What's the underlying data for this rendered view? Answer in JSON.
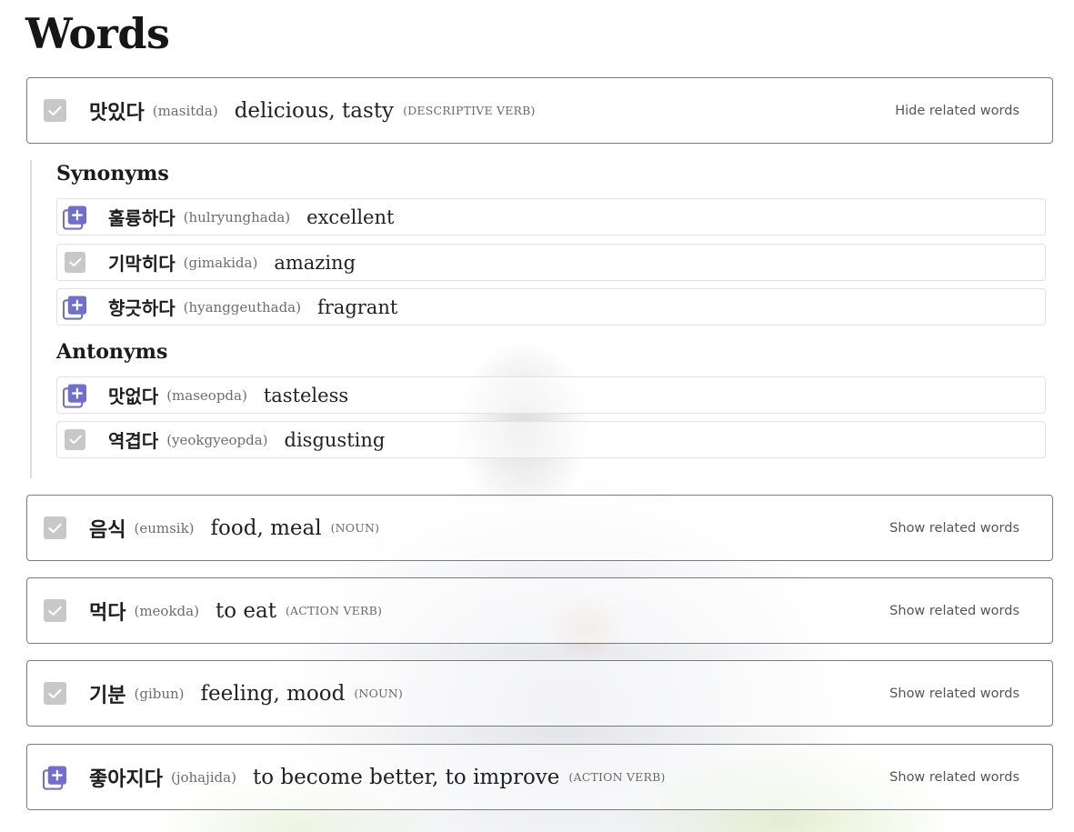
{
  "page": {
    "title": "Words"
  },
  "colors": {
    "add_icon": "#6f6fd0",
    "check_bg": "#c8c8c8",
    "card_border": "#7b7b7b"
  },
  "words": [
    {
      "korean": "맛있다",
      "romanization": "(masitda)",
      "english": "delicious, tasty",
      "pos": "(DESCRIPTIVE VERB)",
      "toggle_label": "Hide related words",
      "status_icon": "check-icon"
    },
    {
      "korean": "음식",
      "romanization": "(eumsik)",
      "english": "food, meal",
      "pos": "(NOUN)",
      "toggle_label": "Show related words",
      "status_icon": "check-icon"
    },
    {
      "korean": "먹다",
      "romanization": "(meokda)",
      "english": "to eat",
      "pos": "(ACTION VERB)",
      "toggle_label": "Show related words",
      "status_icon": "check-icon"
    },
    {
      "korean": "기분",
      "romanization": "(gibun)",
      "english": "feeling, mood",
      "pos": "(NOUN)",
      "toggle_label": "Show related words",
      "status_icon": "check-icon"
    },
    {
      "korean": "좋아지다",
      "romanization": "(johajida)",
      "english": "to become better, to improve",
      "pos": "(ACTION VERB)",
      "toggle_label": "Show related words",
      "status_icon": "add-to-list-icon"
    }
  ],
  "related": {
    "synonyms_heading": "Synonyms",
    "synonyms": [
      {
        "korean": "훌륭하다",
        "romanization": "(hulryunghada)",
        "english": "excellent",
        "status_icon": "add-to-list-icon"
      },
      {
        "korean": "기막히다",
        "romanization": "(gimakida)",
        "english": "amazing",
        "status_icon": "check-icon"
      },
      {
        "korean": "향긋하다",
        "romanization": "(hyanggeuthada)",
        "english": "fragrant",
        "status_icon": "add-to-list-icon"
      }
    ],
    "antonyms_heading": "Antonyms",
    "antonyms": [
      {
        "korean": "맛없다",
        "romanization": "(maseopda)",
        "english": "tasteless",
        "status_icon": "add-to-list-icon"
      },
      {
        "korean": "역겹다",
        "romanization": "(yeokgyeopda)",
        "english": "disgusting",
        "status_icon": "check-icon"
      }
    ]
  }
}
